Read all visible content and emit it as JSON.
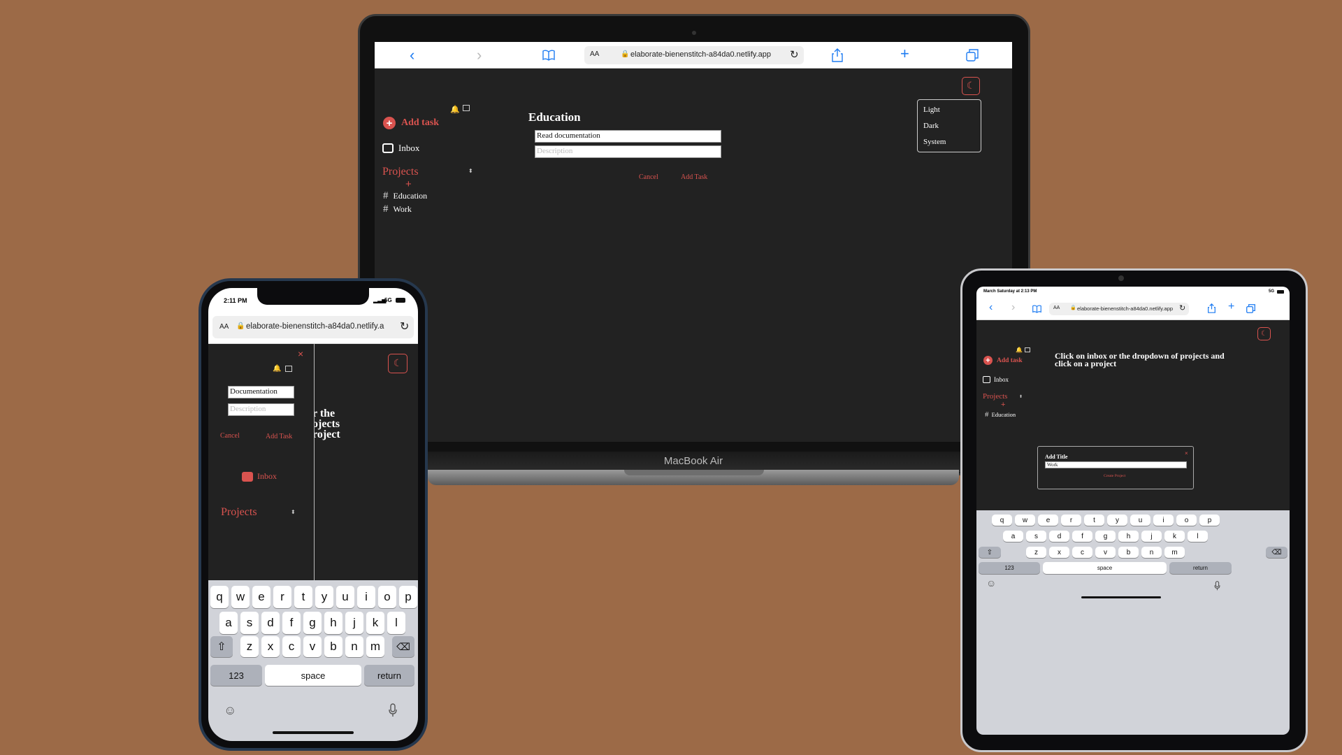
{
  "laptop": {
    "label": "MacBook Air",
    "url": "elaborate-bienenstitch-a84da0.netlify.app",
    "aa": "AA",
    "sidebar": {
      "add_task": "Add task",
      "inbox": "Inbox",
      "projects": "Projects",
      "projects_add": "+",
      "project_items": [
        "Education",
        "Work"
      ]
    },
    "main": {
      "title": "Education",
      "task_name": "Read documentation",
      "description_placeholder": "Description",
      "cancel": "Cancel",
      "add_task": "Add Task"
    },
    "theme_menu": [
      "Light",
      "Dark",
      "System"
    ]
  },
  "phone": {
    "time": "2:11 PM",
    "network": "5G",
    "aa": "AA",
    "url": "elaborate-bienenstitch-a84da0.netlify.a",
    "close": "×",
    "task_name": "Documentation",
    "description_placeholder": "Description",
    "cancel": "Cancel",
    "add_task": "Add Task",
    "inbox": "Inbox",
    "projects": "Projects",
    "behind_text": [
      "r the",
      "ojects",
      "roject"
    ],
    "keyboard": {
      "row1": [
        "q",
        "w",
        "e",
        "r",
        "t",
        "y",
        "u",
        "i",
        "o",
        "p"
      ],
      "row2": [
        "a",
        "s",
        "d",
        "f",
        "g",
        "h",
        "j",
        "k",
        "l"
      ],
      "row3": [
        "z",
        "x",
        "c",
        "v",
        "b",
        "n",
        "m"
      ],
      "numbers": "123",
      "space": "space",
      "return": "return"
    }
  },
  "tablet": {
    "status_date": "March Saturday at 2:13 PM",
    "network": "5G",
    "aa": "AA",
    "url": "elaborate-bienenstitch-a84da0.netlify.app",
    "sidebar": {
      "add_task": "Add task",
      "inbox": "Inbox",
      "projects": "Projects",
      "projects_add": "+",
      "project_items": [
        "Education"
      ]
    },
    "message": "Click on inbox or the dropdown of projects and click on a project",
    "modal": {
      "title": "Add Title",
      "value": "Work",
      "close": "×",
      "button": "Create Project"
    },
    "keyboard": {
      "row1": [
        "q",
        "w",
        "e",
        "r",
        "t",
        "y",
        "u",
        "i",
        "o",
        "p"
      ],
      "row2": [
        "a",
        "s",
        "d",
        "f",
        "g",
        "h",
        "j",
        "k",
        "l"
      ],
      "row3": [
        "z",
        "x",
        "c",
        "v",
        "b",
        "n",
        "m"
      ],
      "numbers": "123",
      "space": "space",
      "return": "return"
    }
  },
  "colors": {
    "background": "#9c6a47",
    "app_bg": "#222222",
    "accent": "#d9534f",
    "safari_blue": "#1e7cf2"
  }
}
